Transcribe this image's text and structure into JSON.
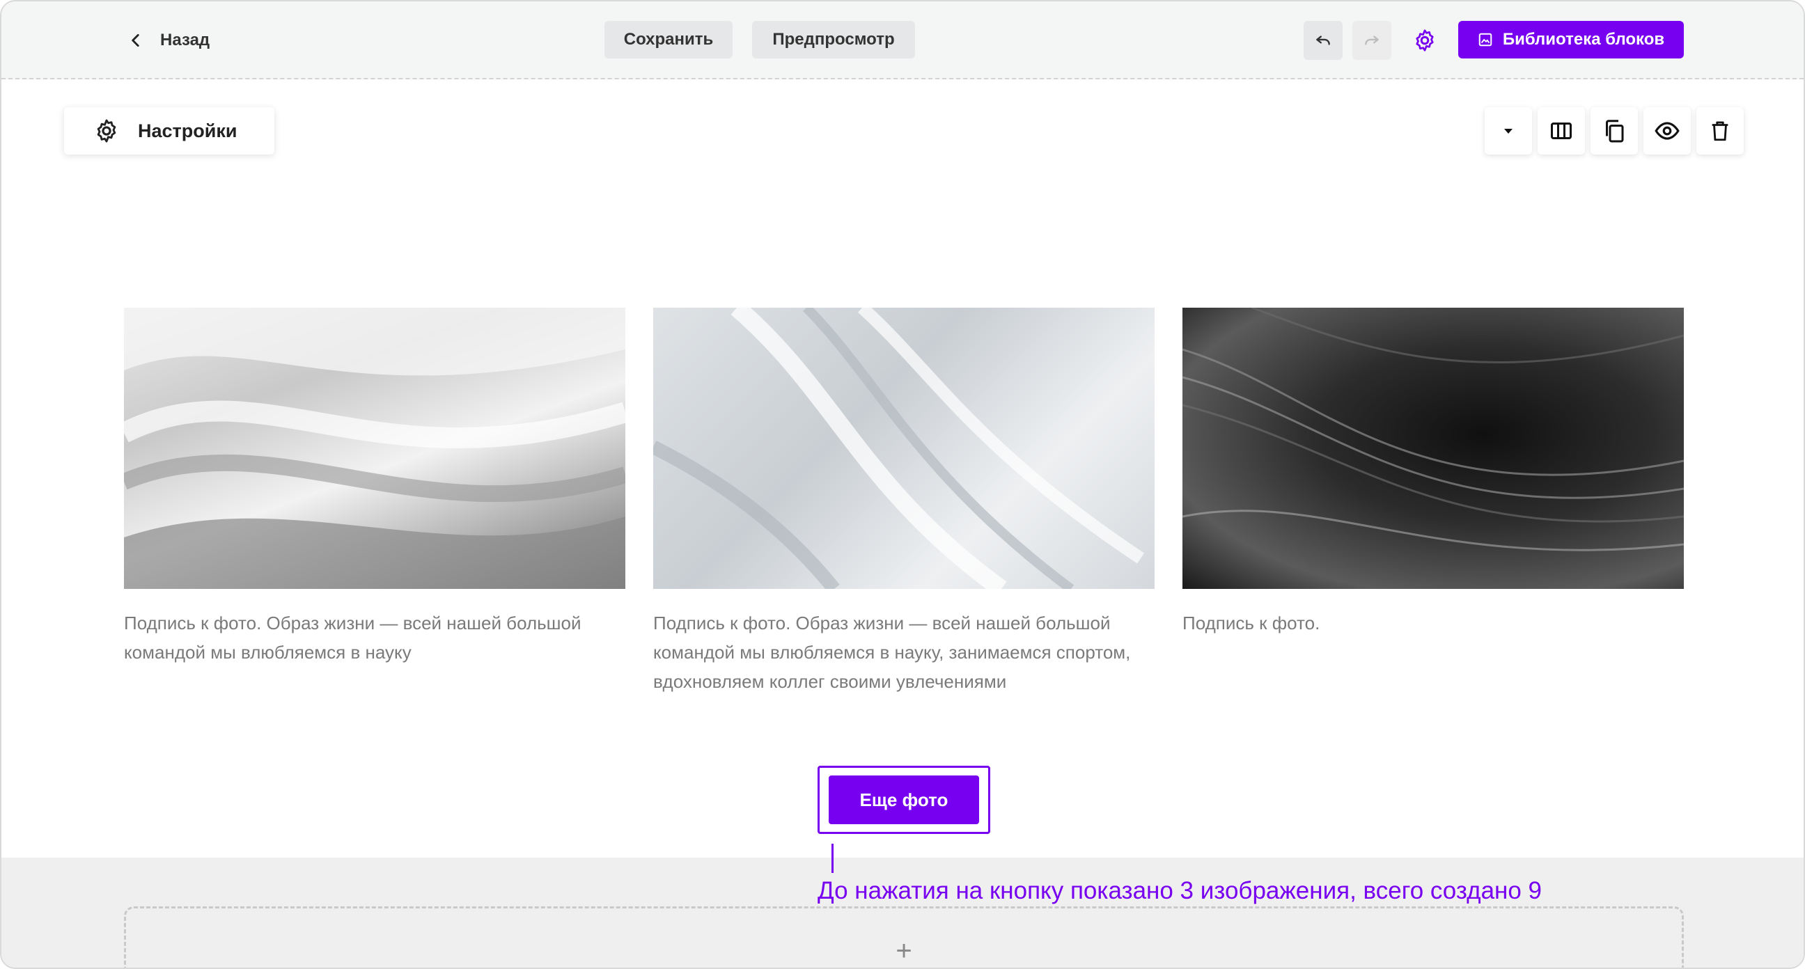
{
  "toolbar": {
    "back_label": "Назад",
    "save_label": "Сохранить",
    "preview_label": "Предпросмотр",
    "library_label": "Библиотека блоков",
    "accent_color": "#7700f0"
  },
  "settings": {
    "label": "Настройки"
  },
  "block_tools": [
    "caret-down-icon",
    "columns-icon",
    "copy-icon",
    "eye-icon",
    "trash-icon"
  ],
  "gallery": {
    "captions": [
      "Подпись к фото. Образ жизни — всей нашей большой командой мы влюбляемся в науку",
      "Подпись к фото. Образ жизни — всей нашей большой командой мы влюбляемся в науку, занимаемся спортом, вдохновляем коллег своими увлечениями",
      "Подпись к фото."
    ],
    "more_button": "Еще фото"
  },
  "annotation": "До нажатия на кнопку показано 3 изображения, всего создано 9",
  "add_block_symbol": "+"
}
